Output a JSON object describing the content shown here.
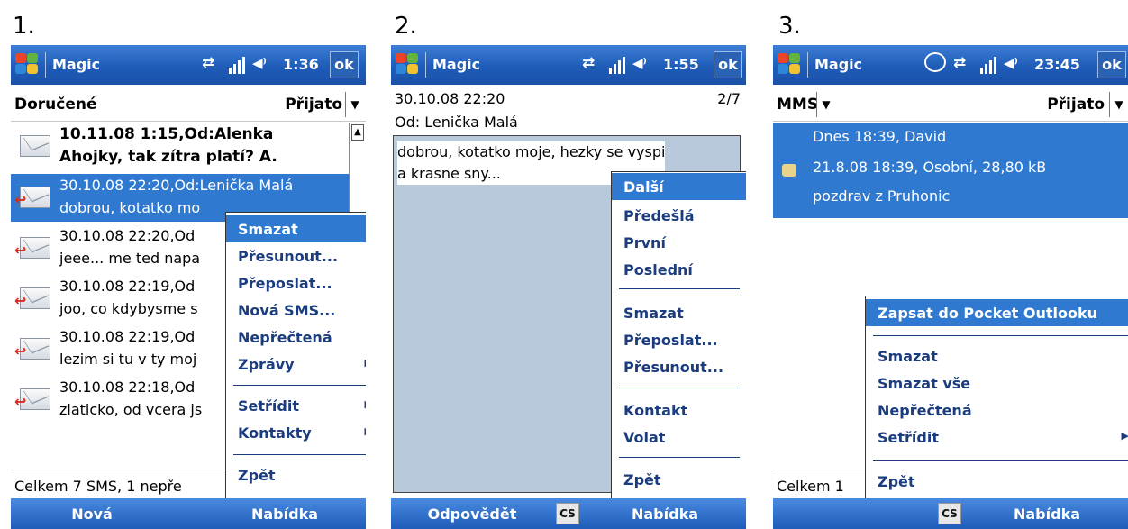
{
  "steps": [
    "1.",
    "2.",
    "3."
  ],
  "screens": [
    {
      "title": "Magic",
      "time": "1:36",
      "ok": "ok",
      "header_left": "Doručené",
      "header_right": "Přijato",
      "messages": [
        {
          "line1": "10.11.08 1:15,Od:Alenka",
          "line2": "Ahojky, tak zítra platí? A.",
          "unread": true
        },
        {
          "line1": "30.10.08 22:20,Od:Lenička Malá",
          "line2": "dobrou, kotatko mo",
          "selected": true
        },
        {
          "line1": "30.10.08 22:20,Od",
          "line2": "jeee... me ted napa"
        },
        {
          "line1": "30.10.08 22:19,Od",
          "line2": "joo, co kdybysme s"
        },
        {
          "line1": "30.10.08 22:19,Od",
          "line2": "lezim si tu v ty moj"
        },
        {
          "line1": "30.10.08 22:18,Od",
          "line2": "zlaticko, od vcera js"
        }
      ],
      "status": "Celkem 7 SMS, 1 nepře",
      "menu": [
        "Smazat",
        "Přesunout...",
        "Přeposlat...",
        "Nová SMS...",
        "Nepřečtená",
        "Zprávy",
        "Setřídit",
        "Kontakty",
        "Zpět"
      ],
      "soft_left": "Nová",
      "soft_right": "Nabídka"
    },
    {
      "title": "Magic",
      "time": "1:55",
      "ok": "ok",
      "date": "30.10.08 22:20",
      "page": "2/7",
      "from": "Od: Lenička Malá",
      "body_line1": "dobrou, kotatko moje, hezky se vyspi",
      "body_line2": "a krasne sny...",
      "menu": [
        "Další",
        "Předešlá",
        "První",
        "Poslední",
        "Smazat",
        "Přeposlat...",
        "Přesunout...",
        "Kontakt",
        "Volat",
        "Zpět"
      ],
      "soft_left": "Odpovědět",
      "cs": "CS",
      "soft_right": "Nabídka"
    },
    {
      "title": "Magic",
      "time": "23:45",
      "ok": "ok",
      "header_left": "MMS",
      "header_right": "Přijato",
      "row_line1": "Dnes  18:39, David",
      "row_line2": "21.8.08  18:39, Osobní, 28,80 kB",
      "row_line3": "pozdrav z Pruhonic",
      "status": "Celkem 1",
      "menu": [
        "Zapsat do Pocket Outlooku",
        "Smazat",
        "Smazat vše",
        "Nepřečtená",
        "Setřídit",
        "Zpět"
      ],
      "cs": "CS",
      "soft_right": "Nabídka"
    }
  ]
}
